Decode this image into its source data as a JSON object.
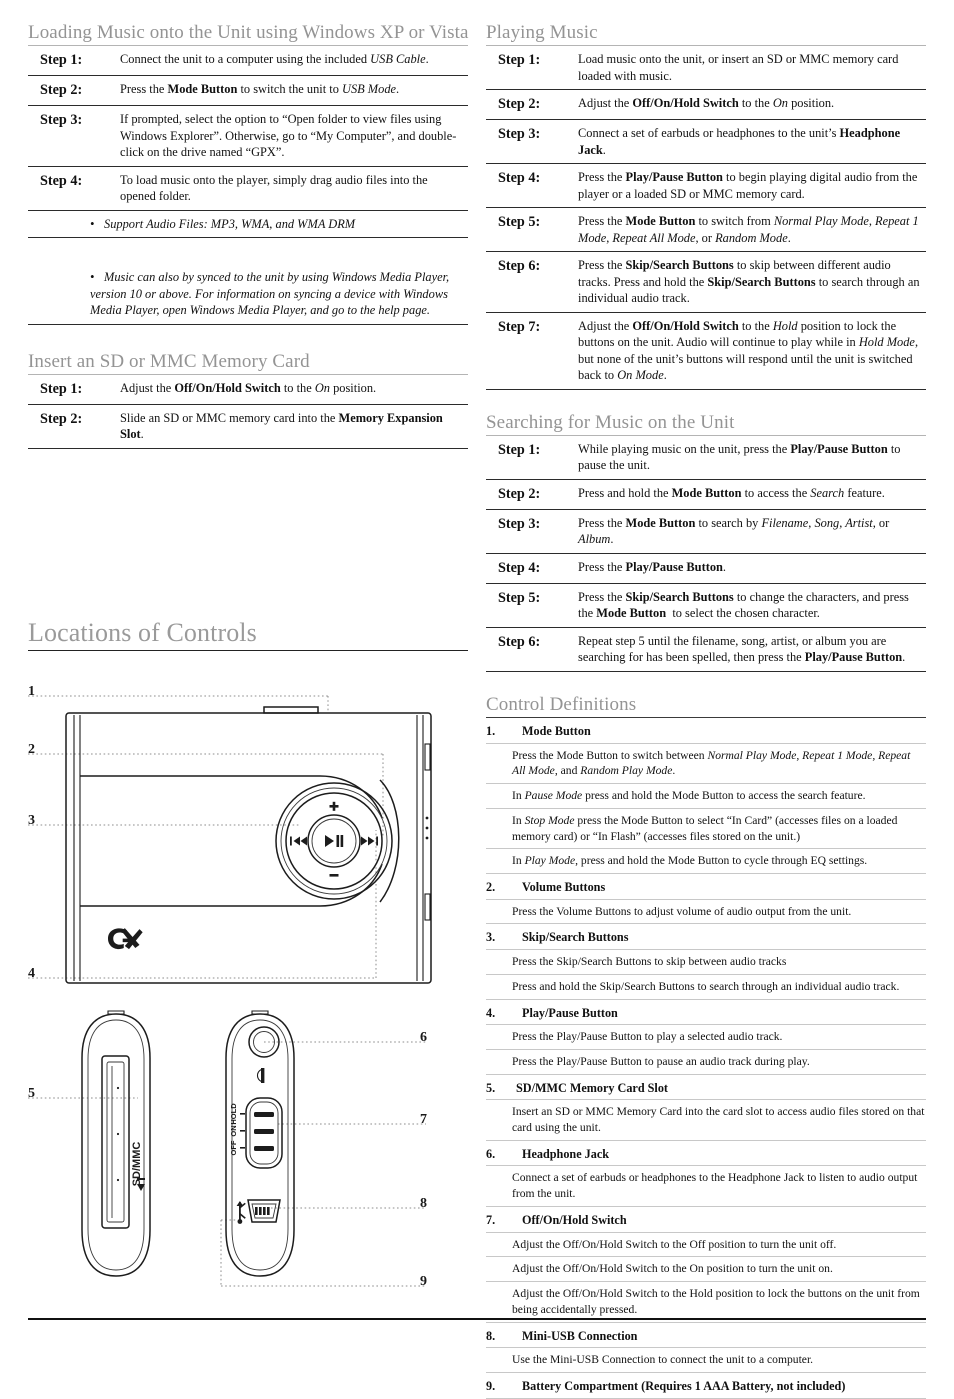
{
  "sections": {
    "loading_music": {
      "heading": "Loading Music onto the Unit using Windows XP or Vista",
      "steps": [
        {
          "label": "Step 1:",
          "text_html": "Connect the unit to a computer using the included <i>USB Cable</i>."
        },
        {
          "label": "Step 2:",
          "text_html": "Press the <b>Mode Button</b> to switch the unit to <i>USB Mode</i>."
        },
        {
          "label": "Step 3:",
          "text_html": "If prompted, select the option to “Open folder to view files using Windows Explorer”. Otherwise, go to “My Computer”, and double-click on the drive named “GPX”."
        },
        {
          "label": "Step 4:",
          "text_html": "To load music onto the player, simply drag audio files into the opened folder."
        }
      ],
      "bullets": [
        "Support Audio Files: MP3, WMA, and WMA DRM",
        "Music can also by synced to the unit by using Windows Media Player, version 10 or above. For information on syncing a device with Windows Media Player, open Windows Media Player, and go to the help page."
      ]
    },
    "insert_card": {
      "heading": "Insert an SD or MMC Memory Card",
      "steps": [
        {
          "label": "Step 1:",
          "text_html": "Adjust the <b>Off/On/Hold Switch</b> to the <i>On</i> position."
        },
        {
          "label": "Step 2:",
          "text_html": "Slide an SD or MMC memory card into the <b>Memory Expansion Slot</b>."
        }
      ]
    },
    "playing_music": {
      "heading": "Playing Music",
      "steps": [
        {
          "label": "Step 1:",
          "text_html": "Load music onto the unit, or insert an SD or MMC memory card loaded with music."
        },
        {
          "label": "Step 2:",
          "text_html": "Adjust the <b>Off/On/Hold Switch</b> to the <i>On</i> position."
        },
        {
          "label": "Step 3:",
          "text_html": "Connect a set of earbuds or headphones to the unit’s <b>Headphone Jack</b>."
        },
        {
          "label": "Step 4:",
          "text_html": "Press the <b>Play/Pause Button</b> to begin playing digital audio from the player or a loaded SD or MMC memory card."
        },
        {
          "label": "Step 5:",
          "text_html": "Press the <b>Mode Button</b> to switch from <i>Normal Play Mode</i>, <i>Repeat 1 Mode</i>, <i>Repeat All Mode</i>, or <i>Random Mode</i>."
        },
        {
          "label": "Step 6:",
          "text_html": "Press the <b>Skip/Search Buttons</b> to skip between different audio tracks. Press and hold the <b>Skip/Search Buttons</b> to search through an individual audio track."
        },
        {
          "label": "Step 7:",
          "text_html": "Adjust the <b>Off/On/Hold Switch</b> to the <i>Hold</i> position to lock the buttons on the unit. Audio will continue to play while in <i>Hold Mode</i>, but none of the unit’s buttons will respond until the unit is switched back to <i>On Mode</i>."
        }
      ]
    },
    "searching_music": {
      "heading": "Searching for Music on the Unit",
      "steps": [
        {
          "label": "Step 1:",
          "text_html": "While playing music on the unit, press the <b>Play/Pause Button</b> to pause the unit."
        },
        {
          "label": "Step 2:",
          "text_html": "Press and hold the <b>Mode Button</b> to access the <i>Search</i> feature."
        },
        {
          "label": "Step 3:",
          "text_html": "Press the <b>Mode Button</b> to search by <i>Filename</i>, <i>Song, Artist,</i> or <i>Album</i>."
        },
        {
          "label": "Step 4:",
          "text_html": "Press the <b>Play/Pause Button</b>."
        },
        {
          "label": "Step 5:",
          "text_html": "Press the <b>Skip/Search Buttons</b> to change the characters, and press the <b>Mode Button</b> &nbsp;to select the chosen character."
        },
        {
          "label": "Step 6:",
          "text_html": "Repeat step 5 until the filename, song, artist, or album you are searching for has been spelled, then press the <b>Play/Pause Button</b>."
        }
      ]
    },
    "locations_of_controls": {
      "heading": "Locations of Controls",
      "callouts": [
        {
          "number": "1"
        },
        {
          "number": "2"
        },
        {
          "number": "3"
        },
        {
          "number": "4"
        },
        {
          "number": "5"
        },
        {
          "number": "6"
        },
        {
          "number": "7"
        },
        {
          "number": "8"
        },
        {
          "number": "9"
        }
      ],
      "device_labels": {
        "card_slot": "SD/MMC",
        "switch_off": "OFF",
        "switch_on": "ON",
        "switch_hold": "HOLD",
        "brand": "GPX",
        "volume_up": "+",
        "volume_down": "−",
        "prev": "⏮",
        "play_pause": "⏯",
        "next": "⏭"
      }
    },
    "control_definitions": {
      "heading": "Control Definitions",
      "items": [
        {
          "number": "1.",
          "title": "Mode Button",
          "lines_html": [
            "Press the Mode Button to switch between <i>Normal Play Mode, Repeat 1 Mode, Repeat All Mode</i>, and <i>Random Play Mode</i>.",
            "In <i>Pause Mode</i> press and hold the Mode Button to access the search feature.",
            "In <i>Stop Mode</i> press the Mode Button to select “In Card” (accesses files on a loaded memory card) or “In Flash” (accesses files stored on the unit.)",
            "In <i>Play Mode</i>, press and hold the Mode Button to cycle through EQ settings."
          ]
        },
        {
          "number": "2.",
          "title": "Volume Buttons",
          "lines_html": [
            "Press the Volume Buttons to adjust volume of audio output from the unit."
          ]
        },
        {
          "number": "3.",
          "title": "Skip/Search Buttons",
          "lines_html": [
            "Press the Skip/Search Buttons to skip between audio tracks",
            "Press and hold the Skip/Search Buttons to search through an individual audio track."
          ]
        },
        {
          "number": "4.",
          "title": "Play/Pause Button",
          "lines_html": [
            "Press the Play/Pause Button to play a selected audio track.",
            "Press the Play/Pause Button to pause an audio track during play."
          ]
        },
        {
          "number": "5.",
          "title": "SD/MMC Memory Card Slot",
          "lines_html": [
            "Insert an SD or MMC Memory Card into the card slot to access audio files stored on that card using the unit."
          ]
        },
        {
          "number": "6.",
          "title": "Headphone Jack",
          "lines_html": [
            "Connect a set of earbuds or headphones to the Headphone Jack to listen to audio output from the unit."
          ]
        },
        {
          "number": "7.",
          "title": "Off/On/Hold Switch",
          "lines_html": [
            "Adjust the Off/On/Hold Switch to the Off position to turn the unit off.",
            "Adjust the Off/On/Hold Switch to the On position to turn the unit on.",
            "Adjust the Off/On/Hold Switch to the Hold position to lock the buttons on the unit from being accidentally pressed."
          ]
        },
        {
          "number": "8.",
          "title": "Mini-USB Connection",
          "lines_html": [
            "Use the Mini-USB Connection to connect the unit to a computer."
          ]
        },
        {
          "number": "9.",
          "title": "Battery Compartment (Requires 1 AAA Battery, not included)",
          "lines_html": []
        }
      ]
    }
  },
  "colors": {
    "heading_gray": "#949494",
    "rule_dark": "#2b2b2b",
    "rule_light": "#c8c8c8",
    "text": "#111111"
  }
}
